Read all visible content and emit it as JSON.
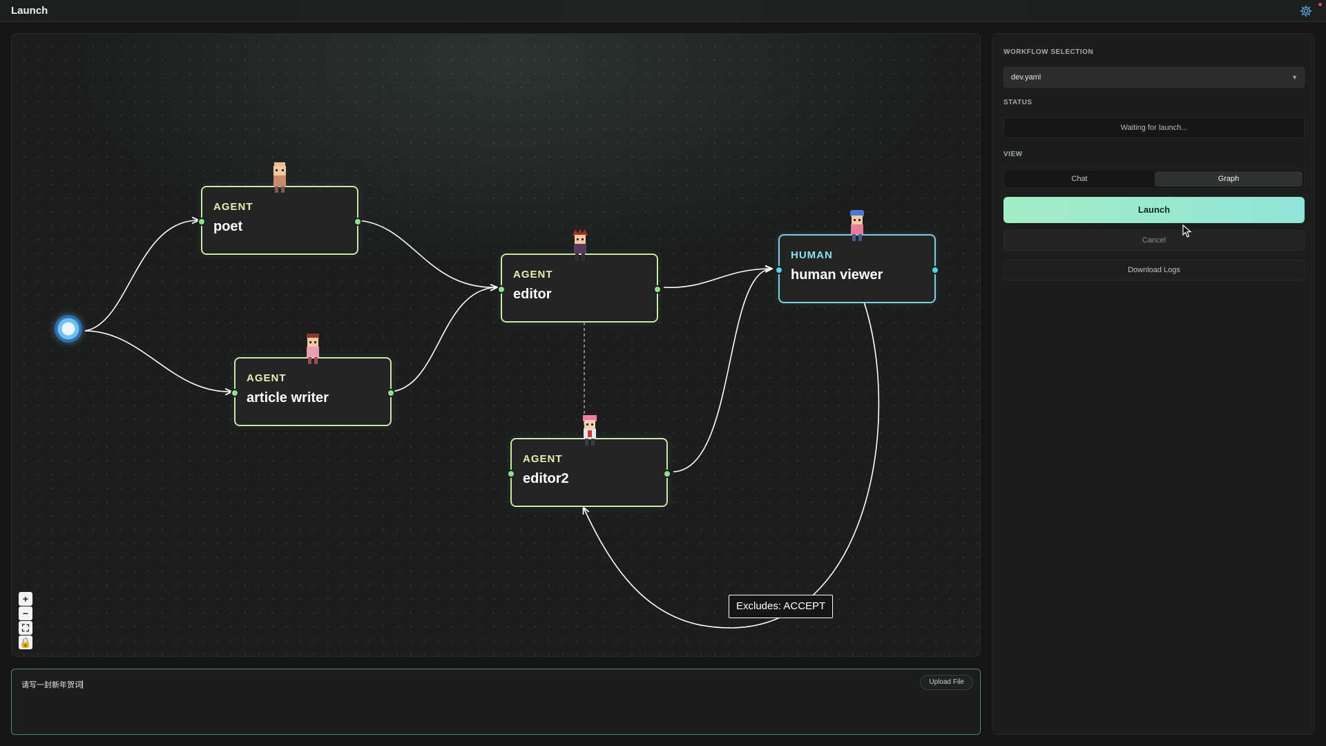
{
  "app": {
    "title": "Launch"
  },
  "canvas": {
    "nodes": [
      {
        "kind": "AGENT",
        "label": "poet"
      },
      {
        "kind": "AGENT",
        "label": "article writer"
      },
      {
        "kind": "AGENT",
        "label": "editor"
      },
      {
        "kind": "AGENT",
        "label": "editor2"
      },
      {
        "kind": "HUMAN",
        "label": "human viewer"
      }
    ],
    "edge_label": "Excludes: ACCEPT",
    "zoom_controls": [
      "+",
      "−",
      "⛶",
      "🔒"
    ]
  },
  "input": {
    "value": "请写一封新年贺词",
    "upload_label": "Upload File"
  },
  "panel": {
    "workflow_title": "WORKFLOW SELECTION",
    "workflow_value": "dev.yaml",
    "status_title": "STATUS",
    "status_value": "Waiting for launch...",
    "view_title": "VIEW",
    "view_options": [
      "Chat",
      "Graph"
    ],
    "view_selected": "Graph",
    "launch_label": "Launch",
    "cancel_label": "Cancel",
    "logs_label": "Download Logs"
  },
  "colors": {
    "agent_border": "#cfe9a8",
    "human_border": "#7fd1e0",
    "launch_gradient_start": "#a4edc4",
    "launch_gradient_end": "#8fe4d9"
  }
}
